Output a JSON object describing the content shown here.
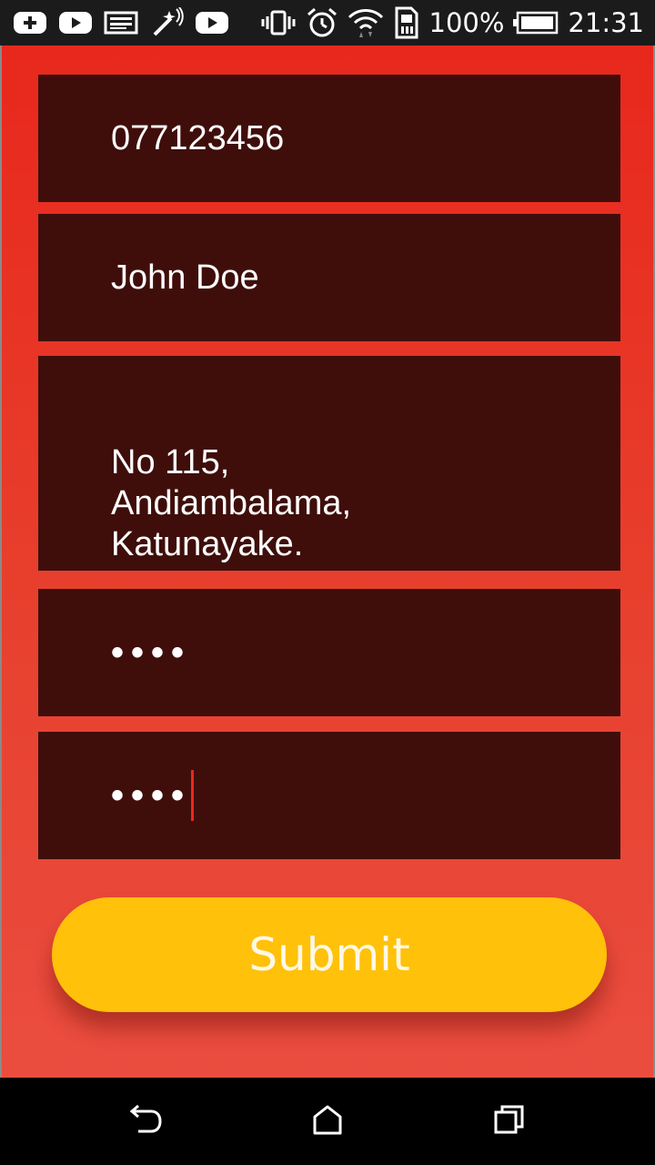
{
  "status_bar": {
    "battery_text": "100%",
    "time": "21:31",
    "left_icons": [
      "add-notification-icon",
      "youtube-icon",
      "image-icon",
      "magic-wand-icon",
      "youtube-icon"
    ],
    "right_icons": [
      "vibrate-icon",
      "alarm-icon",
      "wifi-icon",
      "sim-icon",
      "battery-icon"
    ]
  },
  "form": {
    "phone_value": "077123456",
    "name_value": "John Doe",
    "address_value": "No 115,\nAndiambalama,\nKatunayake.",
    "password_value": "••••",
    "confirm_password_value": "••••",
    "submit_label": "Submit"
  },
  "nav_bar": {
    "icons": [
      "back-icon",
      "home-icon",
      "recent-apps-icon"
    ]
  },
  "colors": {
    "background_top": "#e8281c",
    "background_bottom": "#ea4d3f",
    "field_background": "#3f0e0b",
    "submit_background": "#ffc10a",
    "caret": "#e8281c"
  }
}
